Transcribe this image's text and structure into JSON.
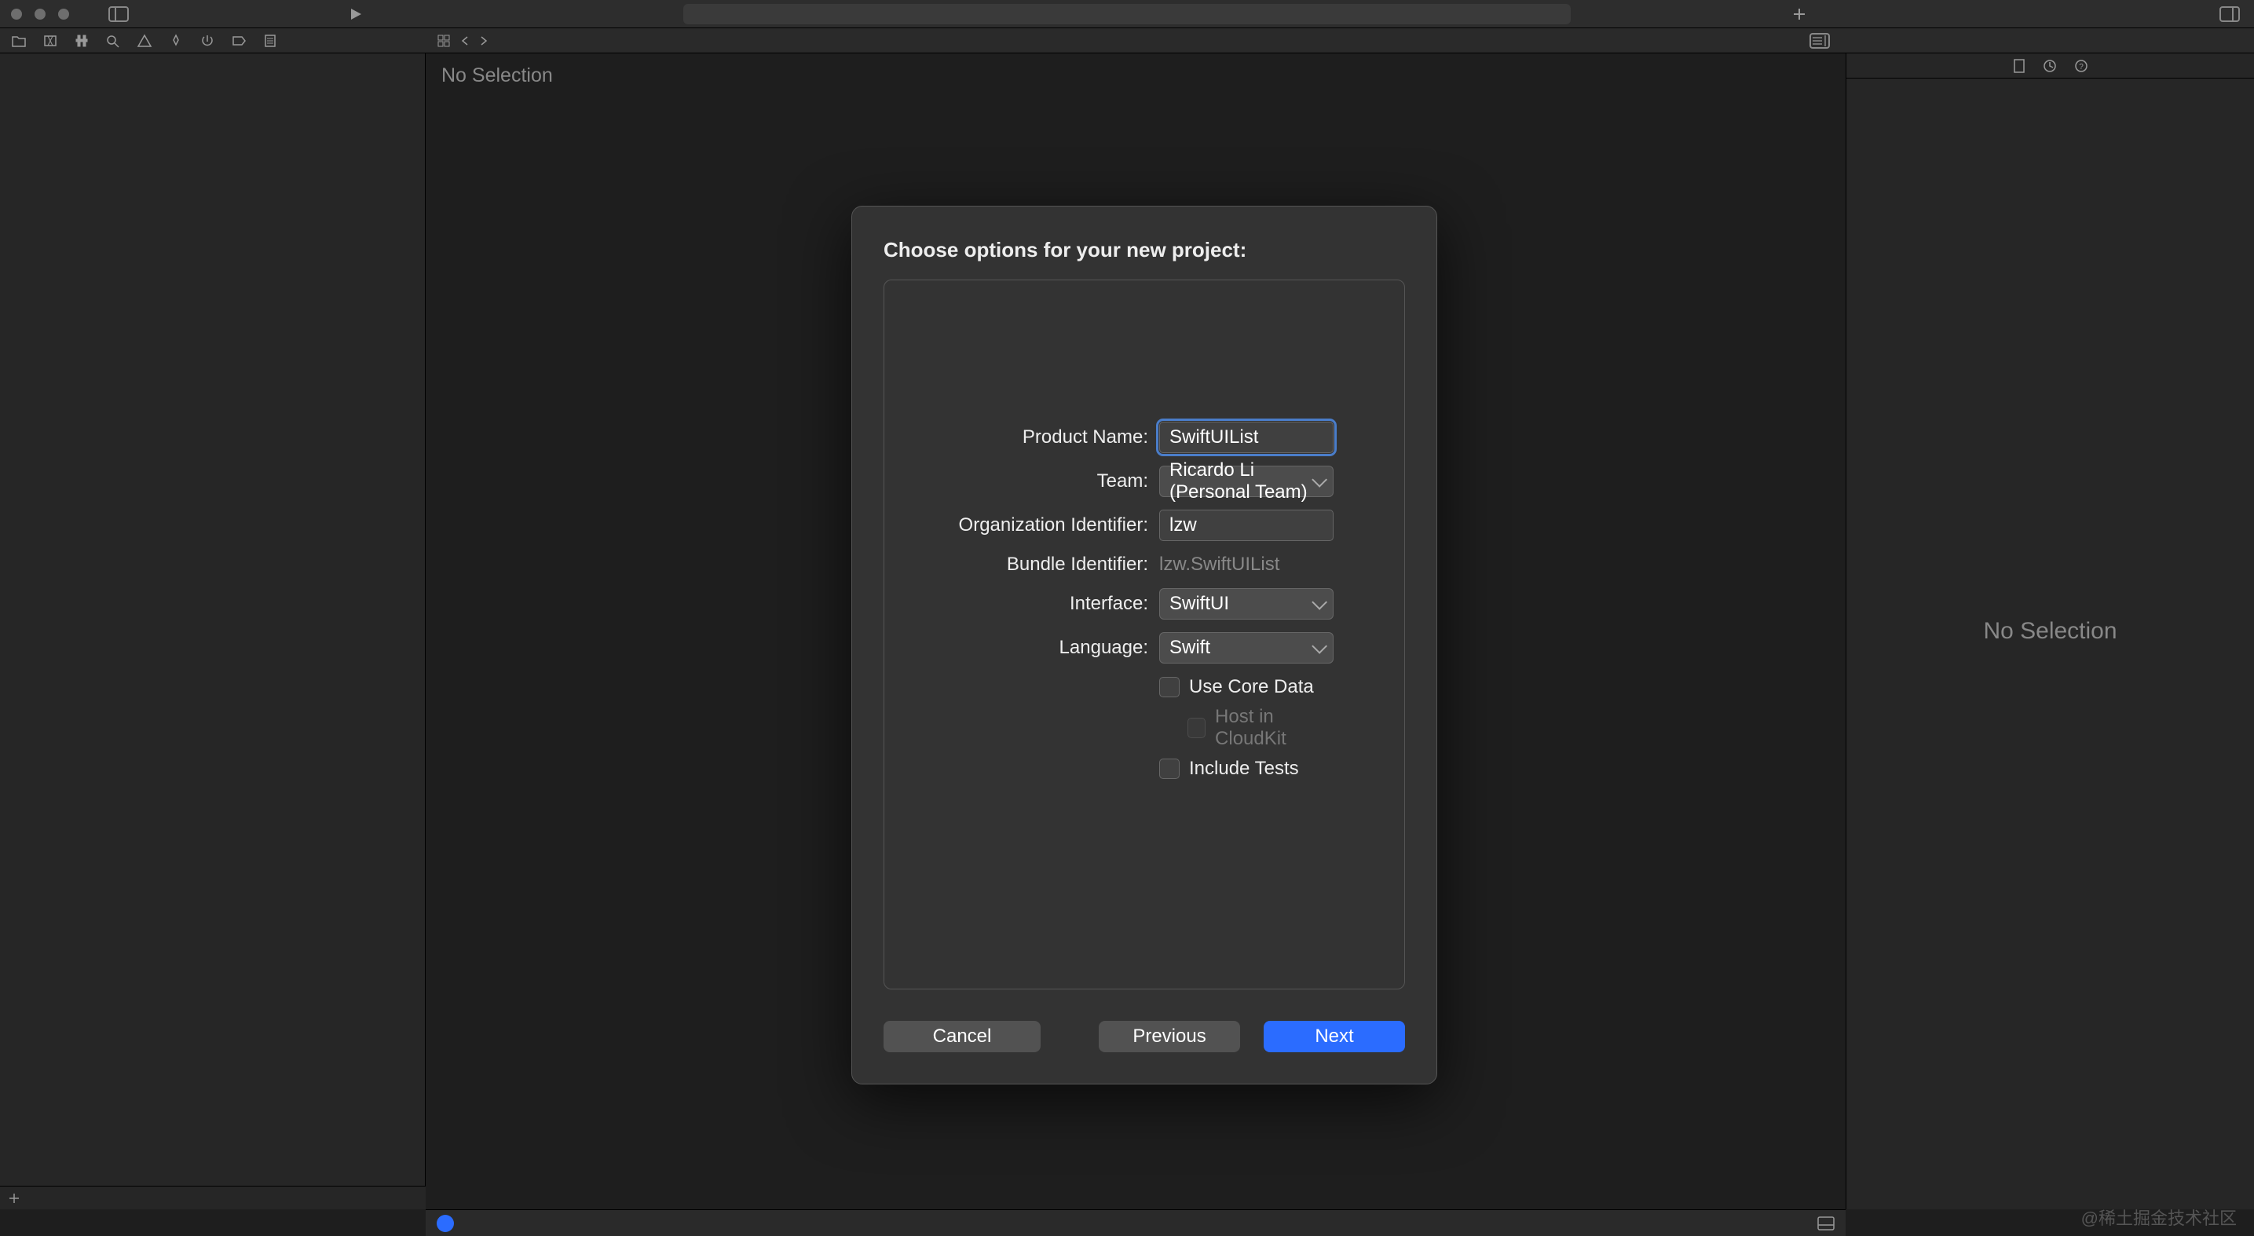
{
  "editor": {
    "no_selection": "No Selection"
  },
  "inspector": {
    "no_selection": "No Selection"
  },
  "modal": {
    "title": "Choose options for your new project:",
    "labels": {
      "product_name": "Product Name:",
      "team": "Team:",
      "org_id": "Organization Identifier:",
      "bundle_id": "Bundle Identifier:",
      "interface": "Interface:",
      "language": "Language:"
    },
    "values": {
      "product_name": "SwiftUIList",
      "team": "Ricardo Li (Personal Team)",
      "org_id": "lzw",
      "bundle_id": "lzw.SwiftUIList",
      "interface": "SwiftUI",
      "language": "Swift"
    },
    "checkboxes": {
      "use_core_data": "Use Core Data",
      "host_cloudkit": "Host in CloudKit",
      "include_tests": "Include Tests",
      "use_core_data_checked": false,
      "host_cloudkit_checked": false,
      "include_tests_checked": false
    },
    "buttons": {
      "cancel": "Cancel",
      "previous": "Previous",
      "next": "Next"
    }
  },
  "watermark": "@稀土掘金技术社区"
}
